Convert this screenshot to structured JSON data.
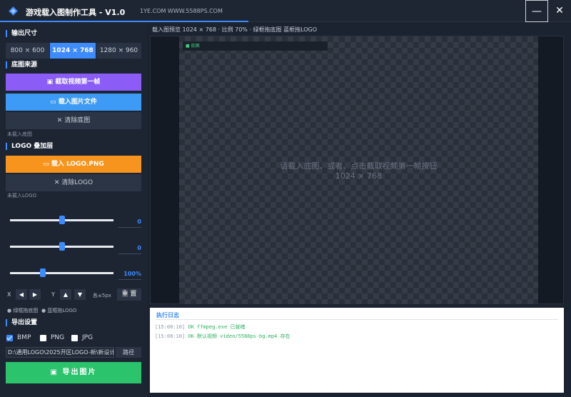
{
  "titlebar": {
    "title": "游戏载入图制作工具 - V1.0",
    "site": "1YE.COM WWW.5588PS.COM",
    "minimize_label": "—",
    "close_label": "✕"
  },
  "output_size": {
    "section": "输出尺寸",
    "options": [
      "800 × 600",
      "1024 × 768",
      "1280 × 960"
    ],
    "selected": "1024 × 768"
  },
  "background": {
    "section": "底图来源",
    "capture_label": "截取视频第一帧",
    "load_label": "载入图片文件",
    "clear_label": "✕  清除底图",
    "status": "未载入底图"
  },
  "logo": {
    "section": "LOGO 叠加层",
    "load_label": "载入 LOGO.PNG",
    "clear_label": "✕  清除LOGO",
    "status": "未载入LOGO"
  },
  "sliders": [
    {
      "value_text": "0",
      "level": 0.5
    },
    {
      "value_text": "0",
      "level": 0.5
    },
    {
      "value_text": "100%",
      "level": 0.32
    }
  ],
  "nudge": {
    "x_label": "X",
    "y_label": "Y",
    "left": "◀",
    "right": "▶",
    "up": "▲",
    "down": "▼",
    "step": "各±5px",
    "reset": "重 置"
  },
  "hints": [
    "● 绿框拖底图",
    "● 蓝框拖LOGO"
  ],
  "export": {
    "section": "导出设置",
    "formats": [
      {
        "label": "BMP",
        "checked": true
      },
      {
        "label": "PNG",
        "checked": false
      },
      {
        "label": "JPG",
        "checked": false
      }
    ],
    "path": "D:\\通用LOGO\\2025开区LOGO-新\\新设计7",
    "path_button": "路径",
    "export_button": "导出图片"
  },
  "preview": {
    "header": "载入图预览   1024 × 768  ·  比例 70%  ·  绿框拖底图   蓝框拖LOGO",
    "layer_tag": "■ 底图",
    "placeholder_line1": "请载入底图、或者、点击截取视频第一帧按钮",
    "placeholder_line2": "1024 × 768"
  },
  "log": {
    "title": "执行日志",
    "lines": [
      {
        "ts": "[15:08:10]",
        "msg": " OK  ffmpeg.exe 已就绪"
      },
      {
        "ts": "[15:08:10]",
        "msg": " OK  默认视频 video/5588ps-bg.mp4 存在"
      }
    ]
  },
  "colors": {
    "accent": "#3d8bff",
    "purple": "#8b5cf6",
    "orange": "#f7941d",
    "green": "#2bc36b"
  }
}
